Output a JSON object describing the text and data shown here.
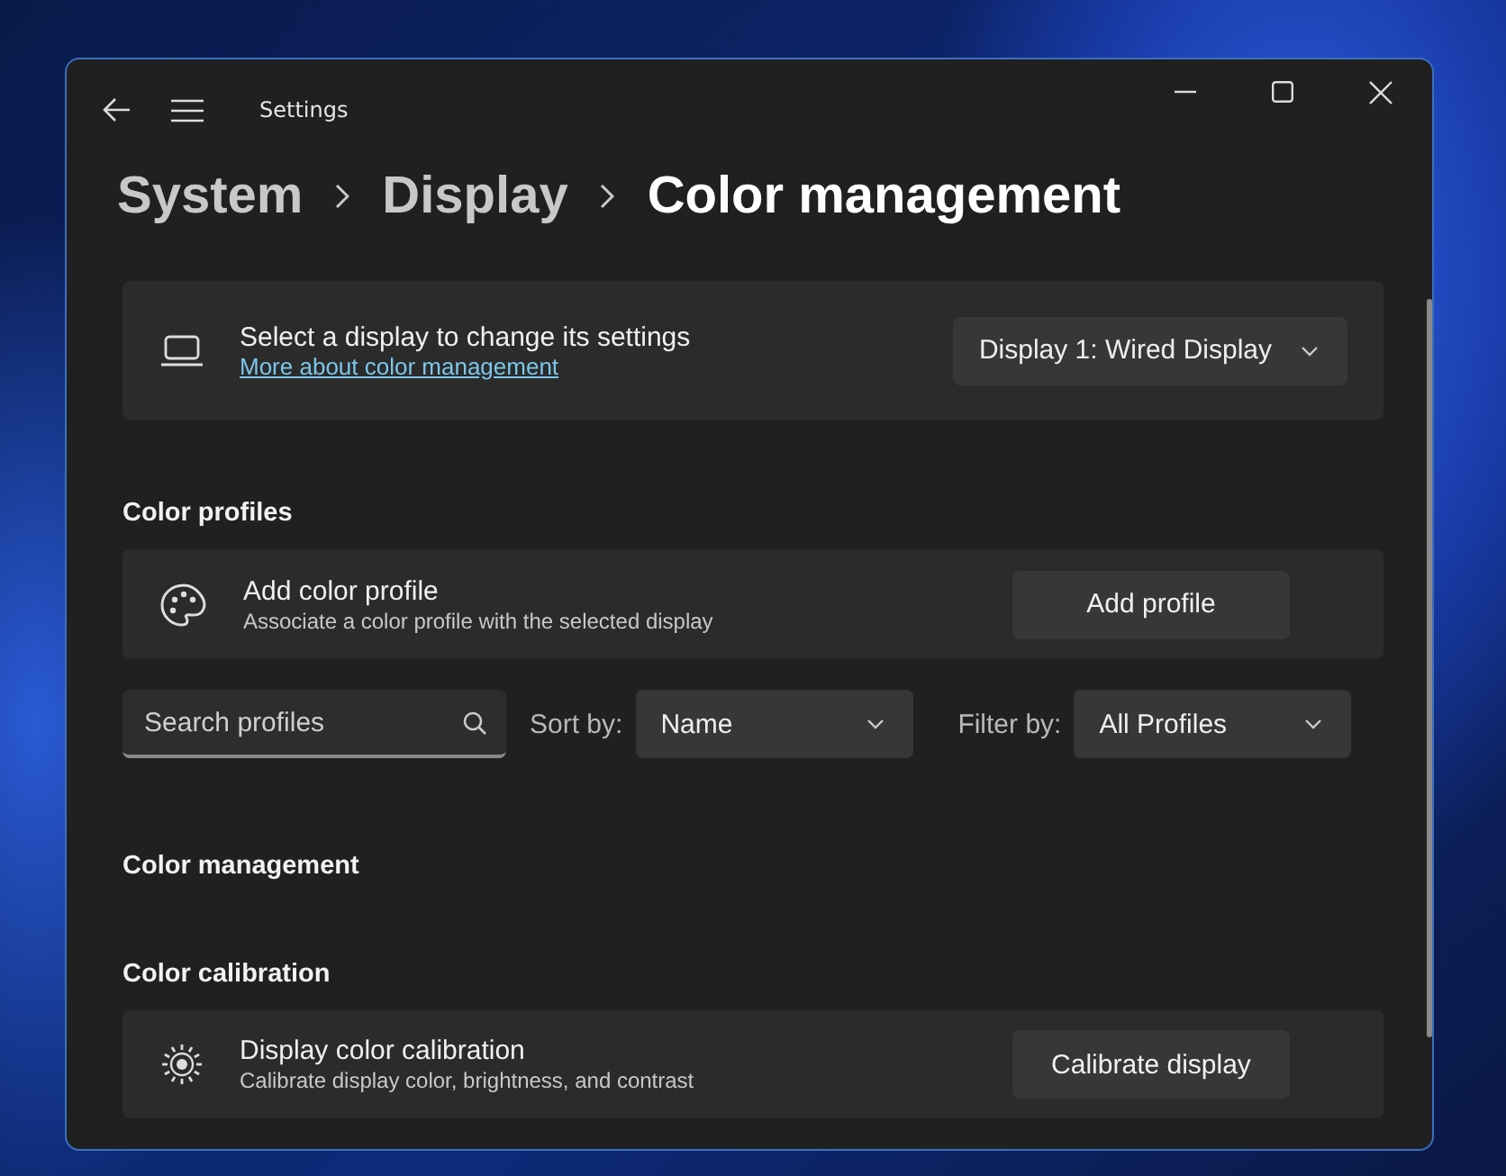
{
  "window": {
    "title": "Settings"
  },
  "breadcrumb": [
    {
      "label": "System",
      "current": false
    },
    {
      "label": "Display",
      "current": false
    },
    {
      "label": "Color management",
      "current": true
    }
  ],
  "display_card": {
    "title": "Select a display to change its settings",
    "link": "More about color management",
    "dropdown": "Display 1: Wired Display"
  },
  "color_profiles": {
    "heading": "Color profiles",
    "add_row": {
      "title": "Add color profile",
      "description": "Associate a color profile with the selected display",
      "button": "Add profile"
    },
    "search": {
      "placeholder": "Search profiles"
    },
    "sort": {
      "label": "Sort by:",
      "value": "Name"
    },
    "filter": {
      "label": "Filter by:",
      "value": "All Profiles"
    }
  },
  "color_management": {
    "heading": "Color management"
  },
  "color_calibration": {
    "heading": "Color calibration",
    "row": {
      "title": "Display color calibration",
      "description": "Calibrate display color, brightness, and contrast",
      "button": "Calibrate display"
    }
  }
}
